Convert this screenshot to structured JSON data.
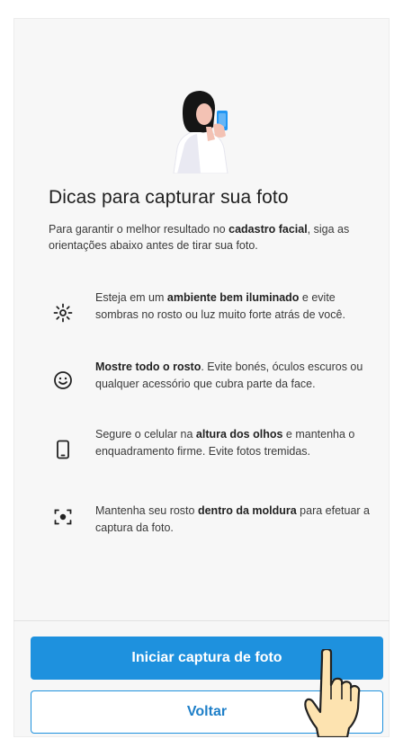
{
  "header": {
    "illustration_icon": "person-taking-selfie-icon",
    "title": "Dicas para capturar sua foto"
  },
  "intro": {
    "part1": "Para garantir o melhor resultado no ",
    "bold": "cadastro facial",
    "part2": ", siga as orientações abaixo antes de tirar sua foto."
  },
  "tips": [
    {
      "icon": "brightness-icon",
      "pre": "Esteja em um ",
      "bold": "ambiente bem iluminado",
      "post": " e evite sombras no rosto ou luz muito forte atrás de você."
    },
    {
      "icon": "smiley-face-icon",
      "pre": "",
      "bold": "Mostre todo o rosto",
      "post": ". Evite bonés, óculos escuros ou qualquer acessório que cubra parte da face."
    },
    {
      "icon": "smartphone-icon",
      "pre": "Segure o celular na ",
      "bold": "altura dos olhos",
      "post": " e mantenha o enquadramento firme. Evite fotos tremidas."
    },
    {
      "icon": "face-frame-icon",
      "pre": "Mantenha seu rosto ",
      "bold": "dentro da moldura",
      "post": " para efetuar a captura da foto."
    }
  ],
  "actions": {
    "primary_label": "Iniciar captura de foto",
    "secondary_label": "Voltar"
  },
  "colors": {
    "accent": "#1e91de",
    "background": "#f7f7f7",
    "illustration_skin": "#f3c2b4",
    "illustration_phone": "#2196f3"
  },
  "overlay": {
    "pointer_icon": "hand-pointer-icon"
  }
}
